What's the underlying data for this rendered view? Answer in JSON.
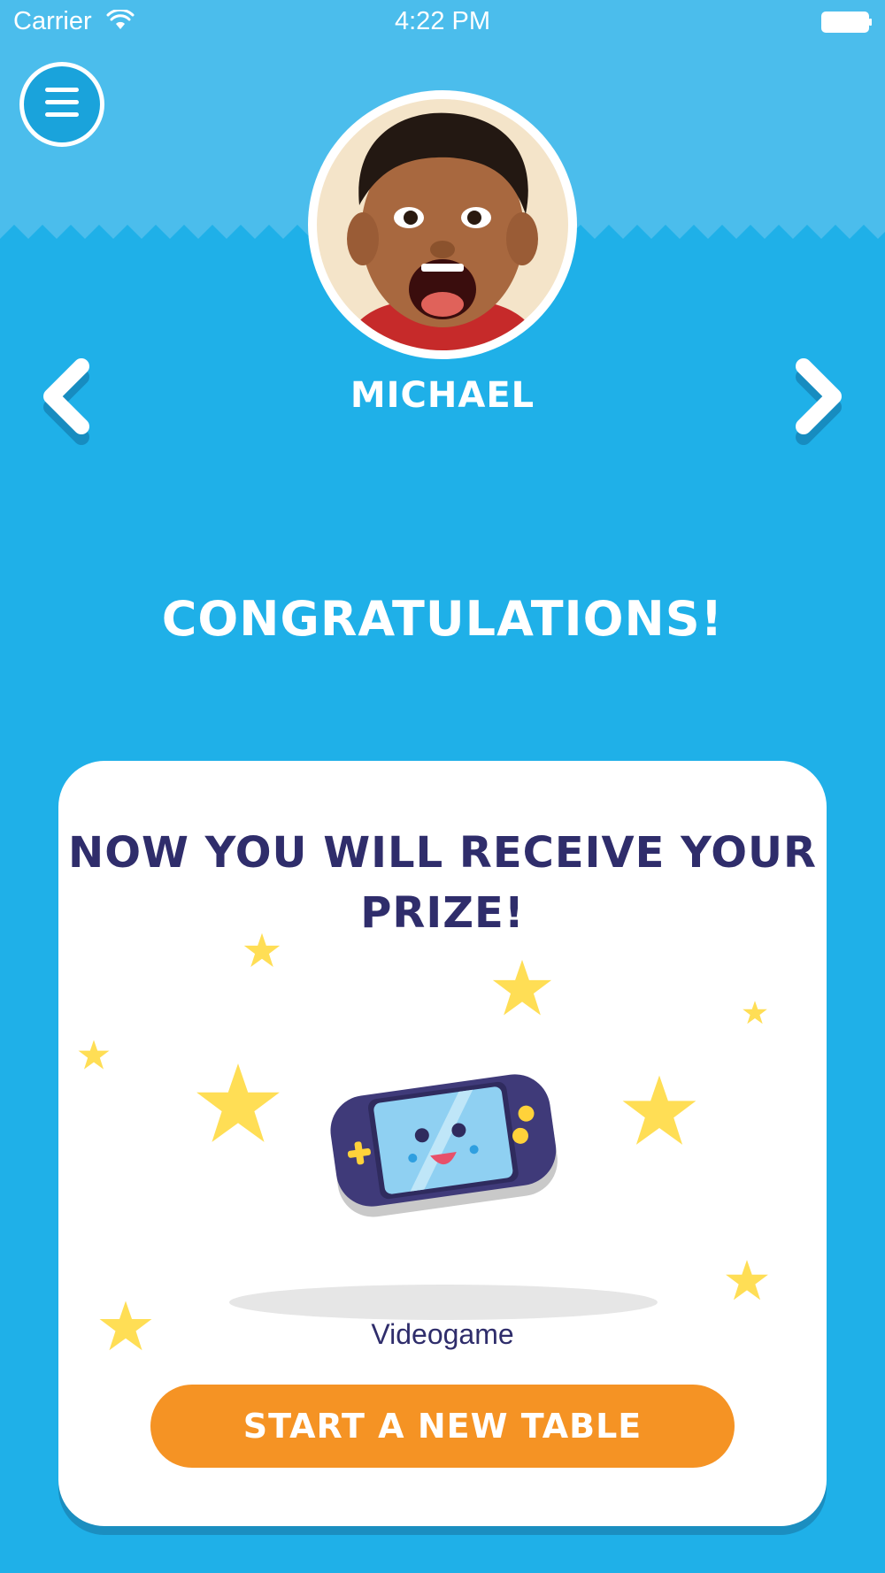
{
  "status_bar": {
    "carrier": "Carrier",
    "time": "4:22 PM"
  },
  "profile": {
    "name": "MICHAEL"
  },
  "headline": "CONGRATULATIONS!",
  "prize_card": {
    "title_line1": "NOW YOU WILL RECEIVE YOUR",
    "title_line2": "PRIZE!",
    "prize_name": "Videogame",
    "prize_icon": "videogame-console-icon",
    "button_label": "START A NEW TABLE"
  },
  "icons": {
    "menu": "hamburger-menu-icon",
    "prev": "chevron-left-icon",
    "next": "chevron-right-icon",
    "decoration": "star-icon"
  },
  "colors": {
    "background": "#1fb0e8",
    "header_band": "#4bbdec",
    "card": "#ffffff",
    "title_text": "#2f2d6b",
    "button": "#f59324",
    "star": "#ffde55"
  }
}
